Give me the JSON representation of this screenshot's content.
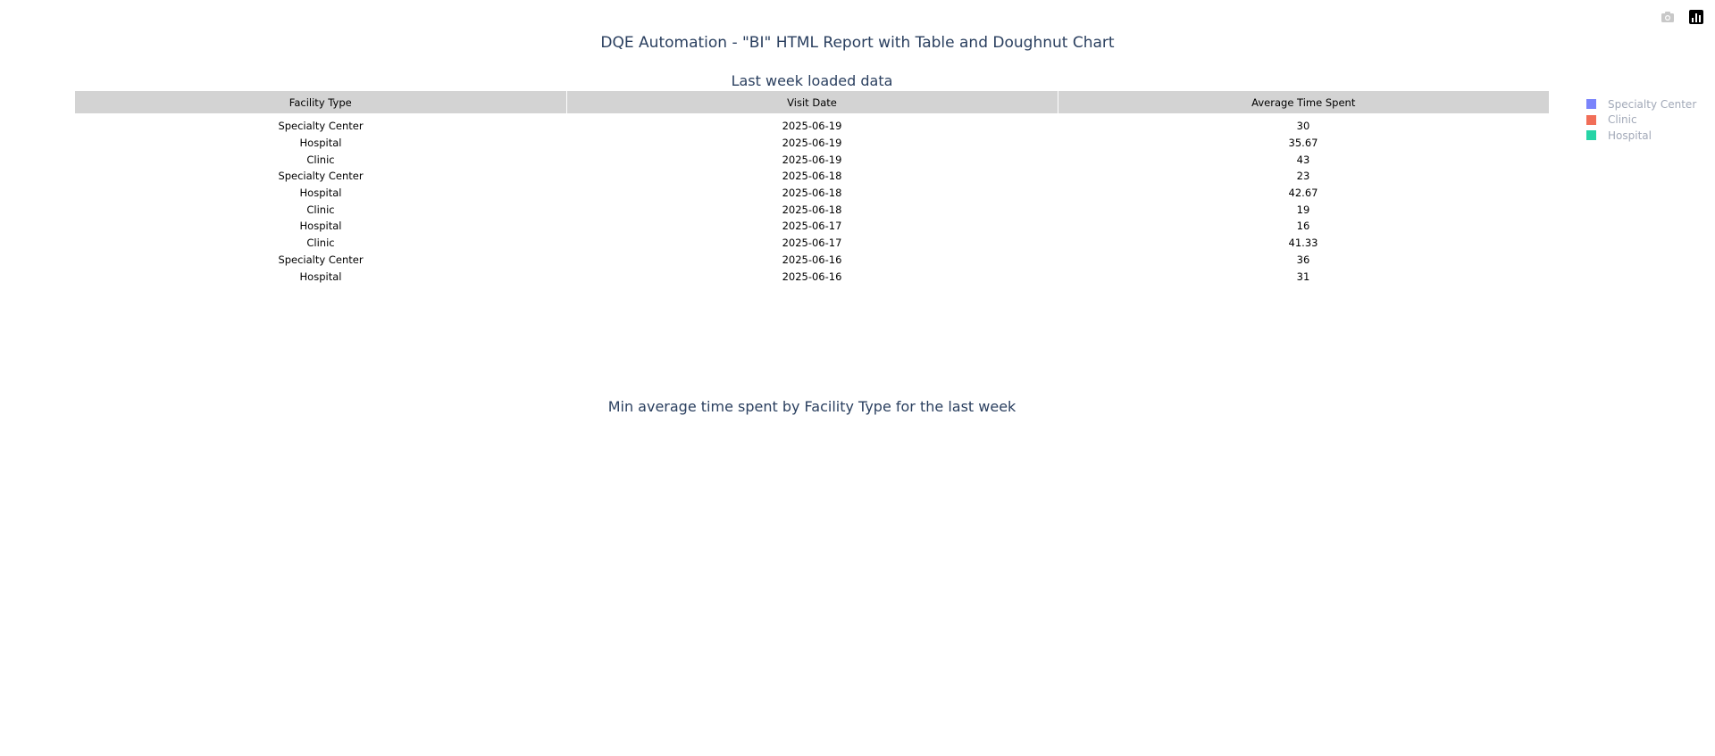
{
  "header": {
    "title": "DQE Automation - \"BI\" HTML Report with Table and Doughnut Chart"
  },
  "modebar": {
    "icons": [
      "camera-icon",
      "plotly-logo-icon"
    ]
  },
  "table": {
    "title": "Last week loaded data",
    "columns": [
      "Facility Type",
      "Visit Date",
      "Average Time Spent"
    ],
    "header_color": "#d3d3d3",
    "rows": [
      [
        "Specialty Center",
        "2025-06-19",
        "30"
      ],
      [
        "Hospital",
        "2025-06-19",
        "35.67"
      ],
      [
        "Clinic",
        "2025-06-19",
        "43"
      ],
      [
        "Specialty Center",
        "2025-06-18",
        "23"
      ],
      [
        "Hospital",
        "2025-06-18",
        "42.67"
      ],
      [
        "Clinic",
        "2025-06-18",
        "19"
      ],
      [
        "Hospital",
        "2025-06-17",
        "16"
      ],
      [
        "Clinic",
        "2025-06-17",
        "41.33"
      ],
      [
        "Specialty Center",
        "2025-06-16",
        "36"
      ],
      [
        "Hospital",
        "2025-06-16",
        "31"
      ]
    ]
  },
  "legend": {
    "items": [
      {
        "label": "Specialty Center",
        "color": "#636efa"
      },
      {
        "label": "Clinic",
        "color": "#ef553b"
      },
      {
        "label": "Hospital",
        "color": "#00cc96"
      }
    ]
  },
  "chart_data": {
    "type": "pie",
    "title": "Min average time spent by Facility Type for the last week",
    "labels": [
      "Specialty Center",
      "Clinic",
      "Hospital"
    ],
    "colors": [
      "#636efa",
      "#ef553b",
      "#00cc96"
    ],
    "values": [],
    "hole": true
  }
}
